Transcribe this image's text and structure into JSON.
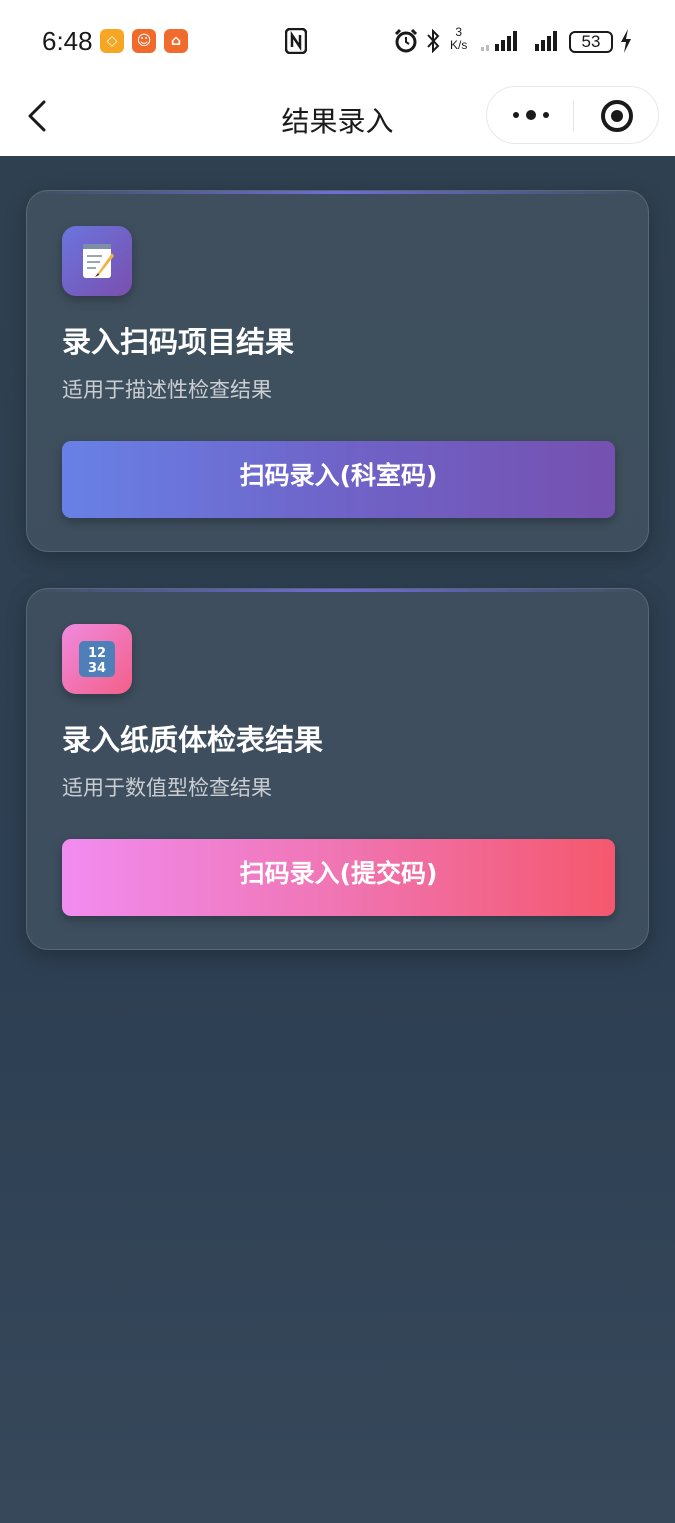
{
  "status_bar": {
    "time": "6:48",
    "net_speed_value": "3",
    "net_speed_unit": "K/s",
    "battery": "53"
  },
  "nav": {
    "title": "结果录入"
  },
  "cards": [
    {
      "title": "录入扫码项目结果",
      "subtitle": "适用于描述性检查结果",
      "button_label": "扫码录入(科室码)",
      "icon": "memo-icon"
    },
    {
      "title": "录入纸质体检表结果",
      "subtitle": "适用于数值型检查结果",
      "button_label": "扫码录入(提交码)",
      "icon": "numbers-icon"
    }
  ],
  "colors": {
    "background": "#2f4050",
    "button_blue_start": "#6881e6",
    "button_blue_end": "#7551b0",
    "button_pink_start": "#f18cf0",
    "button_pink_end": "#f4586d"
  }
}
